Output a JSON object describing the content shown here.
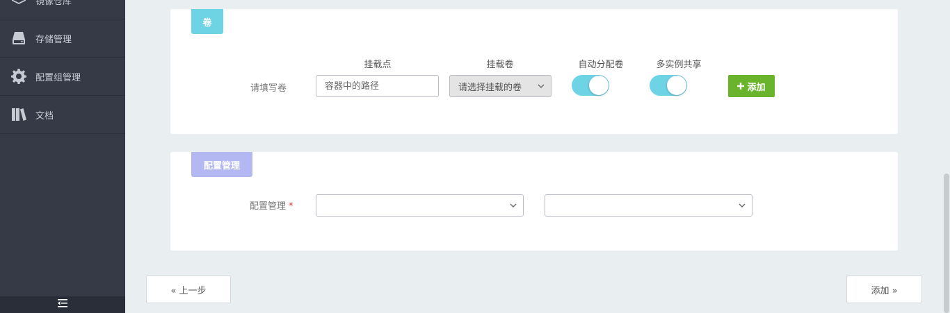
{
  "sidebar": {
    "items": [
      {
        "label": "镜像仓库",
        "icon": "layers-icon"
      },
      {
        "label": "存储管理",
        "icon": "hard-drive-icon"
      },
      {
        "label": "配置组管理",
        "icon": "gear-icon"
      },
      {
        "label": "文档",
        "icon": "books-icon"
      }
    ],
    "footer_icon": "collapse-menu-icon"
  },
  "volume_panel": {
    "tag": "卷",
    "headers": {
      "mount_point": "挂载点",
      "mount_volume": "挂载卷",
      "auto_assign": "自动分配卷",
      "multi_share": "多实例共享"
    },
    "row_label": "请填写卷",
    "path_placeholder": "容器中的路径",
    "volume_select": "请选择挂载的卷",
    "auto_assign_on": true,
    "multi_share_on": true,
    "add_button": "添加"
  },
  "config_panel": {
    "tag": "配置管理",
    "row_label": "配置管理",
    "required_mark": "*",
    "select1_value": "",
    "select2_value": ""
  },
  "nav": {
    "prev": "« 上一步",
    "next": "添加 »"
  },
  "colors": {
    "sidebar_bg": "#353a46",
    "volume_tag": "#6fd3e6",
    "config_tag": "#b3b8f2",
    "toggle_on": "#6fd3e6",
    "add_green": "#6ab42b"
  }
}
